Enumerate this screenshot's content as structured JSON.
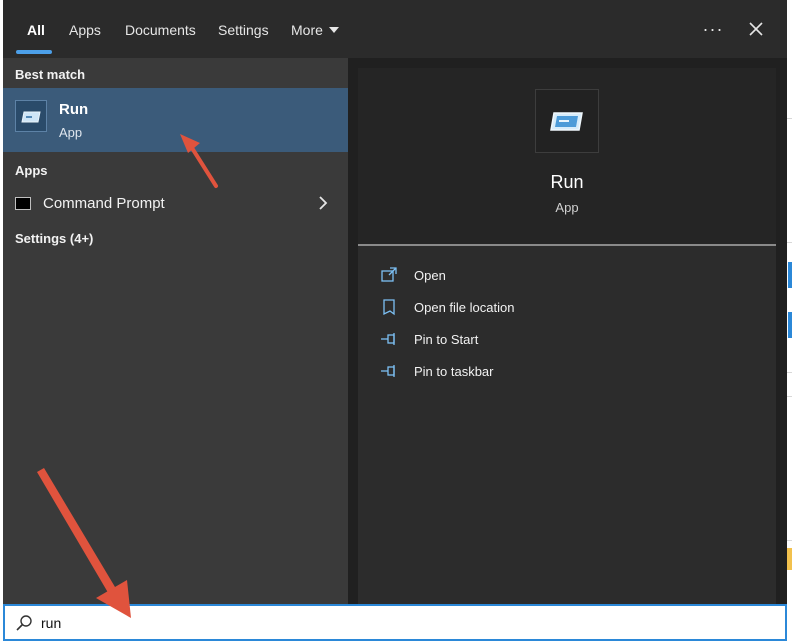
{
  "nav": {
    "tabs": [
      {
        "label": "All",
        "active": true
      },
      {
        "label": "Apps"
      },
      {
        "label": "Documents"
      },
      {
        "label": "Settings"
      },
      {
        "label": "More"
      }
    ],
    "ellipsis": "···",
    "close_icon": "close-icon"
  },
  "results": {
    "best_match_header": "Best match",
    "best_match": {
      "title": "Run",
      "subtitle": "App",
      "icon": "run-icon"
    },
    "apps_header": "Apps",
    "apps": [
      {
        "label": "Command Prompt",
        "icon": "command-prompt-icon"
      }
    ],
    "settings_header": "Settings (4+)"
  },
  "detail": {
    "title": "Run",
    "subtitle": "App",
    "actions": [
      {
        "label": "Open",
        "icon": "open-icon"
      },
      {
        "label": "Open file location",
        "icon": "file-location-icon"
      },
      {
        "label": "Pin to Start",
        "icon": "pin-icon"
      },
      {
        "label": "Pin to taskbar",
        "icon": "pin-icon"
      }
    ]
  },
  "search": {
    "value": "run",
    "icon": "search-icon"
  },
  "colors": {
    "accent": "#4c9fe8",
    "selection": "#3b5b7a",
    "search_border": "#2b88d8",
    "annotation": "#e0533d"
  }
}
